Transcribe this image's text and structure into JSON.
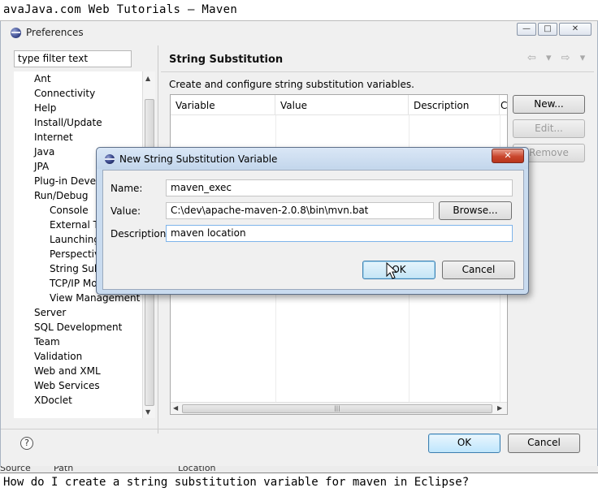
{
  "top_caption": "avaJava.com Web Tutorials – Maven",
  "bottom_caption": "How do I create a string substitution variable for maven in Eclipse?",
  "behind_window_text": [
    "Source",
    "Path",
    "Location"
  ],
  "preferences": {
    "title": "Preferences",
    "window_buttons": {
      "minimize": "—",
      "maximize": "□",
      "close": "✕"
    },
    "filter_placeholder": "type filter text",
    "tree_items": [
      "Ant",
      "Connectivity",
      "Help",
      "Install/Update",
      "Internet",
      "Java",
      "JPA",
      "Plug-in Develo",
      "Run/Debug",
      "Console",
      "External To",
      "Launching",
      "Perspective",
      "String Subs",
      "TCP/IP Mo",
      "View Management",
      "Server",
      "SQL Development",
      "Team",
      "Validation",
      "Web and XML",
      "Web Services",
      "XDoclet"
    ],
    "page_title": "String Substitution",
    "nav_arrows": "⇦ ▾ ⇨ ▾",
    "description": "Create and configure string substitution variables.",
    "table_columns": [
      "Variable",
      "Value",
      "Description",
      "C"
    ],
    "buttons": {
      "new": "New...",
      "edit": "Edit...",
      "remove": "Remove"
    },
    "ok_label": "OK",
    "cancel_label": "Cancel",
    "help_symbol": "?"
  },
  "dialog": {
    "title": "New String Substitution Variable",
    "close_symbol": "✕",
    "name_label": "Name:",
    "name_value": "maven_exec",
    "value_label": "Value:",
    "value_value": "C:\\dev\\apache-maven-2.0.8\\bin\\mvn.bat",
    "browse_label": "Browse...",
    "description_label": "Description:",
    "description_value": "maven location",
    "ok_label": "OK",
    "cancel_label": "Cancel"
  },
  "colors": {
    "dialog_frame": "#c9dbef",
    "default_button": "#bee6fd",
    "close_button": "#c9462d"
  },
  "icons": [
    "eclipse-icon",
    "help-icon",
    "mouse-cursor-icon"
  ]
}
